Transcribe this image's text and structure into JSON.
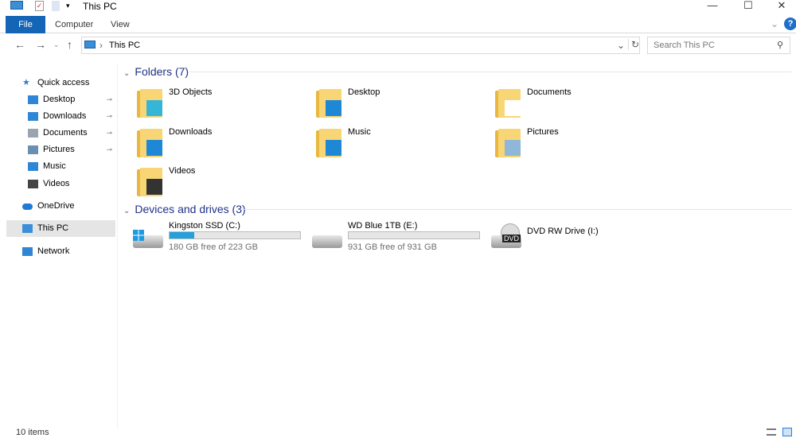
{
  "window": {
    "title": "This PC",
    "minimize": "—",
    "maximize": "☐",
    "close": "✕"
  },
  "ribbon": {
    "tabs": [
      "File",
      "Computer",
      "View"
    ],
    "help": "?",
    "collapse": "⌄"
  },
  "address": {
    "path": "This PC",
    "separator": "›",
    "refresh": "↻",
    "dropdown": "⌄"
  },
  "search": {
    "placeholder": "Search This PC"
  },
  "nav": {
    "back": "←",
    "forward": "→",
    "recent": "⌄",
    "up": "↑"
  },
  "sidebar": {
    "items": [
      {
        "label": "Quick access",
        "icon": "star-icon",
        "color": "#2a7fd4"
      },
      {
        "label": "Desktop",
        "icon": "desktop-icon",
        "color": "#2f86d6",
        "pinned": true
      },
      {
        "label": "Downloads",
        "icon": "download-icon",
        "color": "#2f86d6",
        "pinned": true
      },
      {
        "label": "Documents",
        "icon": "document-icon",
        "color": "#9aa4b0",
        "pinned": true
      },
      {
        "label": "Pictures",
        "icon": "picture-icon",
        "color": "#6b8fb3",
        "pinned": true
      },
      {
        "label": "Music",
        "icon": "music-icon",
        "color": "#2f86d6"
      },
      {
        "label": "Videos",
        "icon": "video-icon",
        "color": "#444"
      },
      {
        "label": "OneDrive",
        "icon": "cloud-icon",
        "color": "#1f7ad6"
      },
      {
        "label": "This PC",
        "icon": "computer-icon",
        "color": "#3a8fd8",
        "selected": true
      },
      {
        "label": "Network",
        "icon": "network-icon",
        "color": "#2f86d6"
      }
    ],
    "pin": "📌"
  },
  "folders": {
    "header": "Folders (7)",
    "items": [
      {
        "name": "3D Objects",
        "overlay": "cube-icon",
        "color": "#35b6d8"
      },
      {
        "name": "Desktop",
        "overlay": "desktop-icon",
        "color": "#1e88d6"
      },
      {
        "name": "Documents",
        "overlay": "document-icon",
        "color": "#ffffff"
      },
      {
        "name": "Downloads",
        "overlay": "download-icon",
        "color": "#1e88d6"
      },
      {
        "name": "Music",
        "overlay": "music-icon",
        "color": "#1e88d6"
      },
      {
        "name": "Pictures",
        "overlay": "picture-icon",
        "color": "#8fb7d8"
      },
      {
        "name": "Videos",
        "overlay": "film-icon",
        "color": "#333333"
      }
    ]
  },
  "drives": {
    "header": "Devices and drives (3)",
    "items": [
      {
        "name": "Kingston SSD (C:)",
        "free": "180 GB free of 223 GB",
        "used_fraction": 0.19,
        "windows": true
      },
      {
        "name": "WD Blue 1TB (E:)",
        "free": "931 GB free of 931 GB",
        "used_fraction": 0.0
      },
      {
        "name": "DVD RW Drive (I:)",
        "badge": "DVD"
      }
    ]
  },
  "status": {
    "count": "10 items"
  }
}
